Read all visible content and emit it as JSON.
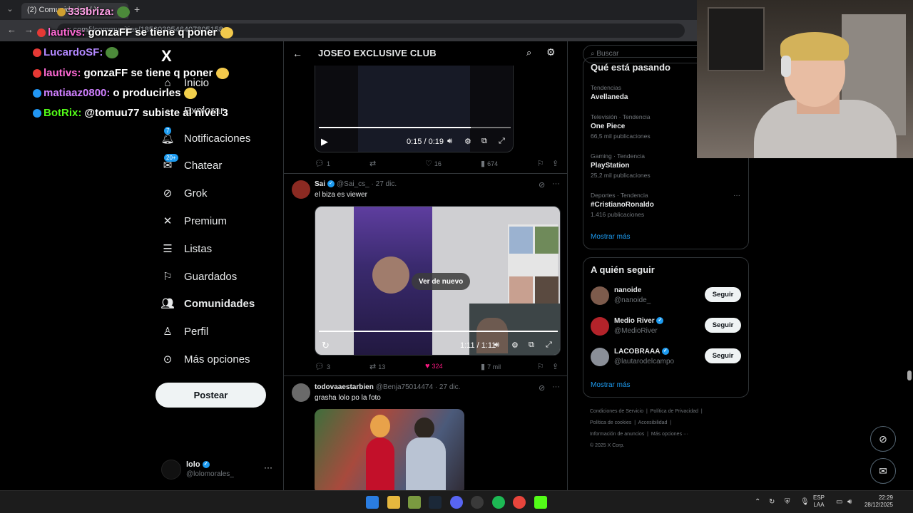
{
  "browser": {
    "tab_title": "(2) Comunidades / X",
    "new_tab": "+",
    "url": "x.com/i/communities/1856039546407805158",
    "back": "←",
    "forward": "→"
  },
  "chat": {
    "lines": [
      {
        "user": "333briza:",
        "message": ""
      },
      {
        "user": "lautivs:",
        "message": "gonzaFF se tiene q poner"
      },
      {
        "user": "LucardoSF:",
        "message": ""
      },
      {
        "user": "lautivs:",
        "message": "gonzaFF se tiene q poner"
      },
      {
        "user": "matiaaz0800:",
        "message": "o producirles"
      },
      {
        "user": "BotRix:",
        "message": "@tomuu77 subiste al nivel 3"
      }
    ]
  },
  "nav": {
    "logo": "X",
    "items": [
      {
        "label": "Inicio",
        "icon": "home-icon"
      },
      {
        "label": "Explorar",
        "icon": "search-icon"
      },
      {
        "label": "Notificaciones",
        "icon": "bell-icon",
        "badge": "7"
      },
      {
        "label": "Chatear",
        "icon": "mail-icon",
        "badge": "20+"
      },
      {
        "label": "Grok",
        "icon": "grok-icon"
      },
      {
        "label": "Premium",
        "icon": "x-icon"
      },
      {
        "label": "Listas",
        "icon": "list-icon"
      },
      {
        "label": "Guardados",
        "icon": "bookmark-icon"
      },
      {
        "label": "Comunidades",
        "icon": "people-icon"
      },
      {
        "label": "Perfil",
        "icon": "person-icon"
      },
      {
        "label": "Más opciones",
        "icon": "more-circle-icon"
      }
    ],
    "post_button": "Postear",
    "profile": {
      "name": "lolo",
      "handle": "@lolomorales_",
      "more": "···"
    }
  },
  "main": {
    "title": "JOSEO EXCLUSIVE CLUB",
    "back_icon": "←",
    "video1": {
      "time": "0:15 / 0:19",
      "progress": 0.79
    },
    "tweet1_stats": {
      "replies": "1",
      "retweets": "",
      "likes": "16",
      "views": "674"
    },
    "tweet2": {
      "name": "Sai",
      "handle": "@Sai_cs_",
      "date": "· 27 dic.",
      "text": "el biza es viewer",
      "replay": "Ver de nuevo",
      "video_time": "1:11 / 1:11",
      "progress": 1.0,
      "stats": {
        "replies": "3",
        "retweets": "13",
        "likes": "324",
        "views": "7 mil"
      }
    },
    "tweet3": {
      "name": "todovaaestarbien",
      "handle": "@Benja75014474",
      "date": "· 27 dic.",
      "text": "grasha lolo po la foto"
    }
  },
  "right": {
    "search_placeholder": "Buscar",
    "trends_title": "Qué está pasando",
    "trends": [
      {
        "meta": "Tendencias",
        "name": "Avellaneda",
        "count": ""
      },
      {
        "meta": "Televisión · Tendencia",
        "name": "One Piece",
        "count": "66,5 mil publicaciones"
      },
      {
        "meta": "Gaming · Tendencia",
        "name": "PlayStation",
        "count": "25,2 mil publicaciones"
      },
      {
        "meta": "Deportes · Tendencia",
        "name": "#CristianoRonaldo",
        "count": "1.416 publicaciones"
      }
    ],
    "show_more": "Mostrar más",
    "follow_title": "A quién seguir",
    "follow": [
      {
        "name": "nanoide",
        "handle": "@nanoide_",
        "verified": false,
        "button": "Seguir"
      },
      {
        "name": "Medio River",
        "handle": "@MedioRiver",
        "verified": true,
        "button": "Seguir"
      },
      {
        "name": "LACOBRAAA",
        "handle": "@lautarodelcampo",
        "verified": true,
        "button": "Seguir"
      }
    ],
    "footer": {
      "row1": [
        "Condiciones de Servicio",
        "Política de Privacidad"
      ],
      "row2": [
        "Política de cookies",
        "Accesibilidad"
      ],
      "row3": [
        "Información de anuncios",
        "Más opciones ···"
      ],
      "copyright": "© 2025 X Corp."
    }
  },
  "taskbar": {
    "lang_top": "ESP",
    "lang_bottom": "LAA",
    "time": "22:29",
    "date": "28/12/2025"
  },
  "colors": {
    "accent": "#1d9bf0",
    "like": "#f91880",
    "background": "#000000"
  }
}
